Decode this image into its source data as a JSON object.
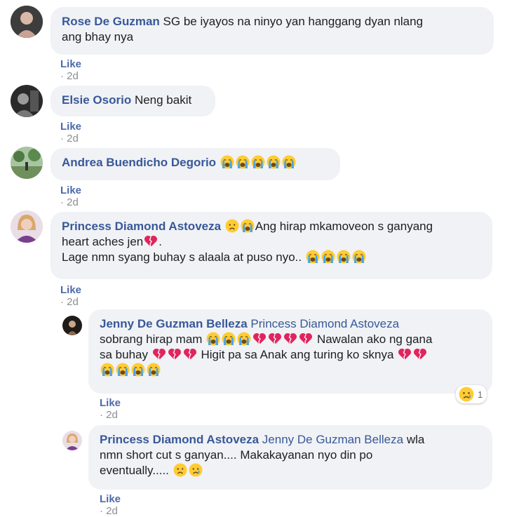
{
  "comments": [
    {
      "author": "Rose De Guzman",
      "text_1": "SG be iyayos na ninyo yan hanggang dyan nlang",
      "text_2": "ang bhay nya",
      "like": "Like",
      "sep": "·",
      "time": "2d"
    },
    {
      "author": "Elsie Osorio",
      "text_1": "Neng bakit",
      "like": "Like",
      "sep": "·",
      "time": "2d"
    },
    {
      "author": "Andrea Buendicho Degorio",
      "like": "Like",
      "sep": "·",
      "time": "2d"
    },
    {
      "author": "Princess Diamond Astoveza",
      "text_1": "Ang hirap mkamoveon s ganyang",
      "text_2": "heart aches jen",
      "text_2_end": ".",
      "text_3": "Lage nmn syang buhay s alaala at puso nyo..",
      "like": "Like",
      "sep": "·",
      "time": "2d"
    }
  ],
  "replies": [
    {
      "author": "Jenny De Guzman Belleza",
      "mention": "Princess Diamond Astoveza",
      "text_1": "sobrang hirap mam",
      "text_1_end": "Nawalan ako ng gana",
      "text_2": "sa buhay",
      "text_2_end": "Higit pa sa Anak ang turing ko sknya",
      "reaction_count": "1",
      "like": "Like",
      "sep": "·",
      "time": "2d"
    },
    {
      "author": "Princess Diamond Astoveza",
      "mention": "Jenny De Guzman Belleza",
      "text_1": "wla",
      "text_2": "nmn short cut s ganyan.... Makakayanan nyo din po",
      "text_3": "eventually.....",
      "like": "Like",
      "sep": "·",
      "time": "2d"
    }
  ],
  "colors": {
    "author": "#385898",
    "bubble": "#f0f2f5",
    "meta": "#8a8d91",
    "broken_heart": "#e0245e",
    "emoji_face": "#ffcc33"
  },
  "icons": [
    "crying-face-emoji",
    "broken-heart-emoji",
    "sad-face-emoji",
    "sad-reaction-icon"
  ]
}
